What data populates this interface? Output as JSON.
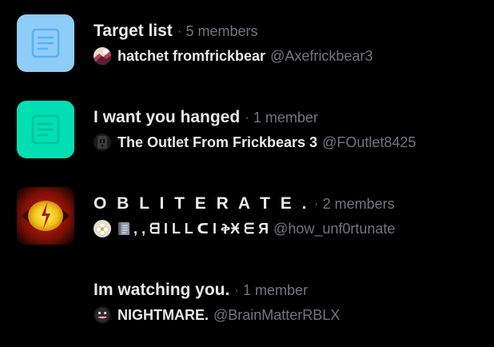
{
  "colors": {
    "background": "#000000",
    "primary_text": "#e7e9ea",
    "secondary_text": "#71767b",
    "list_icon_blue_bg": "#8ecdf8",
    "list_icon_blue_fg": "#56b3f5",
    "list_icon_teal_bg": "#00dfb4",
    "list_icon_teal_fg": "#00c199"
  },
  "lists": [
    {
      "name": "Target list",
      "members": "5 members",
      "thumbnail_icon": "document-list-icon",
      "owner": {
        "display_name": "hatchet fromfrickbear",
        "handle": "@Axefrickbear3",
        "avatar_icon": "avatar-hatchet-icon"
      }
    },
    {
      "name": "I want you hanged",
      "members": "1 member",
      "thumbnail_icon": "document-list-icon",
      "owner": {
        "display_name": "The Outlet From Frickbears 3",
        "handle": "@FOutlet8425",
        "avatar_icon": "avatar-outlet-icon"
      }
    },
    {
      "name": "O B L I T E R A T E .",
      "members": "2 members",
      "thumbnail_icon": "eye-cover-image-icon",
      "owner": {
        "display_name": ", , ᗺ I L L  ᑕ I ቅӾ ᗴ Я",
        "handle": "@how_unf0rtunate",
        "avatar_icon": "avatar-flower-icon",
        "badge_icon": "book-emoji-icon"
      }
    },
    {
      "name": "Im watching you.",
      "members": "1 member",
      "thumbnail_icon": "",
      "owner": {
        "display_name": "NIGHTMARE.",
        "handle": "@BrainMatterRBLX",
        "avatar_icon": "avatar-nightmare-icon"
      }
    }
  ],
  "separator": "·"
}
